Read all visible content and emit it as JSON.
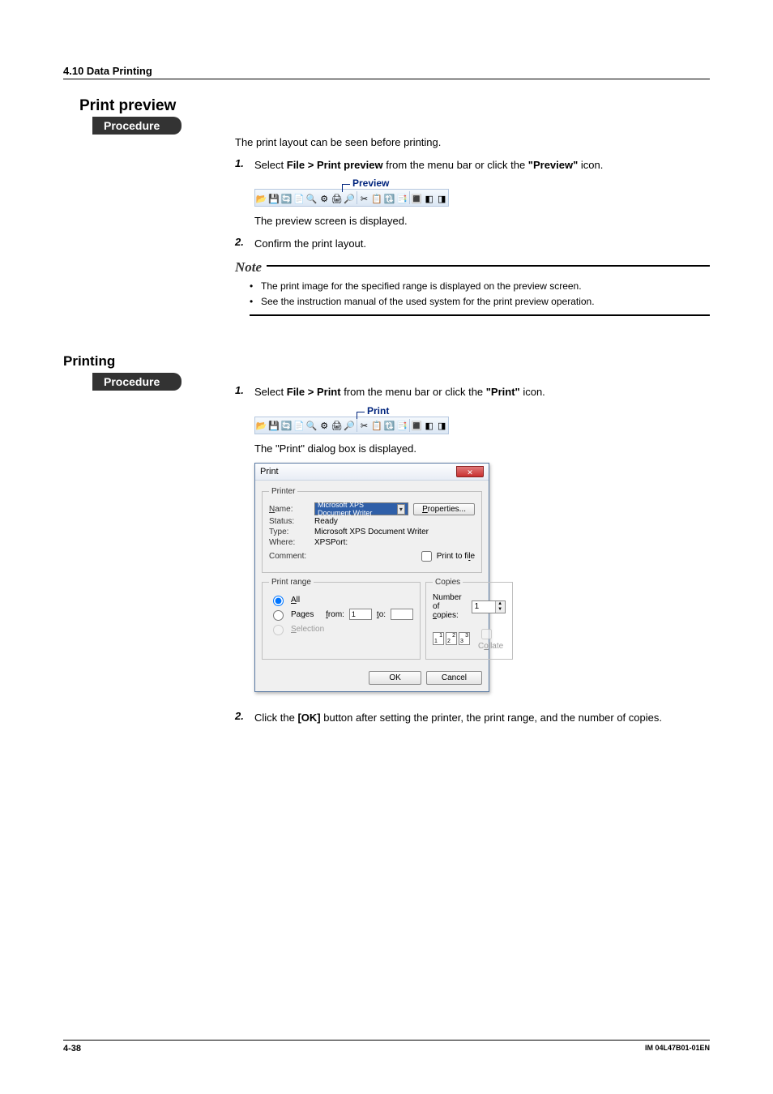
{
  "section_header": "4.10  Data Printing",
  "preview": {
    "heading": "Print preview",
    "procedure_label": "Procedure",
    "intro": "The print layout can be seen before printing.",
    "step1_pre": "Select ",
    "step1_bold": "File > Print preview",
    "step1_mid": " from the menu bar or click the ",
    "step1_quote": "\"Preview\"",
    "step1_post": " icon.",
    "callout": "Preview",
    "after_toolbar": "The preview screen is displayed.",
    "step2": "Confirm the print layout.",
    "note_label": "Note",
    "note1": "The print image for the specified range is displayed on the preview screen.",
    "note2": "See the instruction manual of the used system for the print preview operation."
  },
  "printing": {
    "heading": "Printing",
    "procedure_label": "Procedure",
    "step1_pre": "Select ",
    "step1_bold": "File > Print",
    "step1_mid": " from the menu bar or click the ",
    "step1_quote": "\"Print\"",
    "step1_post": " icon.",
    "callout": "Print",
    "after_toolbar": "The \"Print\" dialog box is displayed.",
    "step2_pre": "Click the ",
    "step2_bold": "[OK]",
    "step2_post": " button after setting the printer, the print range, and the number of copies."
  },
  "dialog": {
    "title": "Print",
    "printer_legend": "Printer",
    "name_label": "Name:",
    "name_value": "Microsoft XPS Document Writer",
    "properties_btn": "Properties...",
    "status_label": "Status:",
    "status_value": "Ready",
    "type_label": "Type:",
    "type_value": "Microsoft XPS Document Writer",
    "where_label": "Where:",
    "where_value": "XPSPort:",
    "comment_label": "Comment:",
    "print_to_file": "Print to file",
    "range_legend": "Print range",
    "range_all": "All",
    "range_pages": "Pages",
    "range_from": "from:",
    "range_from_val": "1",
    "range_to": "to:",
    "range_selection": "Selection",
    "copies_legend": "Copies",
    "copies_num_label": "Number of copies:",
    "copies_num_val": "1",
    "collate": "Collate",
    "ok": "OK",
    "cancel": "Cancel"
  },
  "toolbar_icons": [
    "📂",
    "💾",
    "🔄",
    "📄",
    "🔍",
    "⚙",
    "🖨",
    "🔎",
    "",
    "✂",
    "📋",
    "🔃",
    "📑",
    "",
    "🔳",
    "◧",
    "◨"
  ],
  "footer": {
    "page": "4-38",
    "doc": "IM 04L47B01-01EN"
  }
}
